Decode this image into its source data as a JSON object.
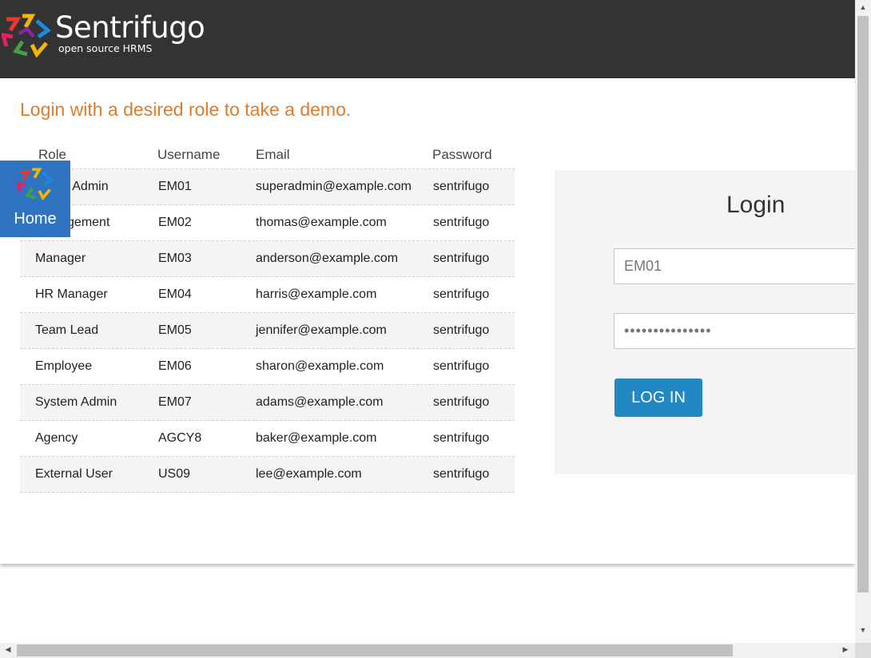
{
  "brand": {
    "name": "Sentrifugo",
    "tagline": "open source HRMS",
    "logo_icon": "sentrifugo-logo-icon"
  },
  "demo": {
    "heading": "Login with a desired role to take a demo."
  },
  "table": {
    "headers": [
      "Role",
      "Username",
      "Email",
      "Password"
    ],
    "rows": [
      {
        "role": "Super Admin",
        "username": "EM01",
        "email": "superadmin@example.com",
        "password": "sentrifugo"
      },
      {
        "role": "Management",
        "username": "EM02",
        "email": "thomas@example.com",
        "password": "sentrifugo"
      },
      {
        "role": "Manager",
        "username": "EM03",
        "email": "anderson@example.com",
        "password": "sentrifugo"
      },
      {
        "role": "HR Manager",
        "username": "EM04",
        "email": "harris@example.com",
        "password": "sentrifugo"
      },
      {
        "role": "Team Lead",
        "username": "EM05",
        "email": "jennifer@example.com",
        "password": "sentrifugo"
      },
      {
        "role": "Employee",
        "username": "EM06",
        "email": "sharon@example.com",
        "password": "sentrifugo"
      },
      {
        "role": "System Admin",
        "username": "EM07",
        "email": "adams@example.com",
        "password": "sentrifugo"
      },
      {
        "role": "Agency",
        "username": "AGCY8",
        "email": "baker@example.com",
        "password": "sentrifugo"
      },
      {
        "role": "External User",
        "username": "US09",
        "email": "lee@example.com",
        "password": "sentrifugo"
      }
    ]
  },
  "home_button": {
    "label": "Home",
    "icon": "sentrifugo-logo-icon"
  },
  "login": {
    "title": "Login",
    "username_value": "EM01",
    "password_value": "•••••••••••••••",
    "button_label": "LOG IN"
  },
  "colors": {
    "header_bg": "#333333",
    "heading_orange": "#e07b2a",
    "home_blue": "#2e74c0",
    "login_button_blue": "#2188c4",
    "panel_bg": "#f4f4f4"
  }
}
